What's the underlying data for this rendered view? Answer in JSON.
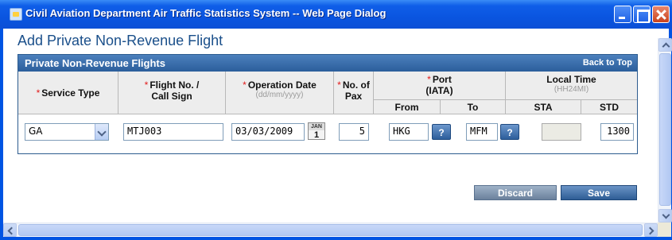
{
  "window": {
    "title": "Civil Aviation Department Air Traffic Statistics System -- Web Page Dialog"
  },
  "page": {
    "heading": "Add Private Non-Revenue Flight"
  },
  "panel": {
    "title": "Private Non-Revenue Flights",
    "back_to_top": "Back to Top"
  },
  "columns": {
    "required_marker": "*",
    "service_type": "Service Type",
    "flight_no": "Flight No. /",
    "call_sign": "Call Sign",
    "operation_date": "Operation Date",
    "operation_date_hint": "(dd/mm/yyyy)",
    "no_of": "No. of",
    "pax": "Pax",
    "port": "Port",
    "iata": "(IATA)",
    "from": "From",
    "to": "To",
    "local_time": "Local Time",
    "local_time_hint": "(HH24MI)",
    "sta": "STA",
    "std": "STD"
  },
  "form": {
    "service_type": "GA",
    "flight_no": "MTJ003",
    "operation_date": "03/03/2009",
    "calendar_month": "JAN",
    "calendar_day": "1",
    "pax": "5",
    "from": "HKG",
    "to": "MFM",
    "sta": "",
    "std": "1300",
    "help_label": "?"
  },
  "actions": {
    "discard": "Discard",
    "save": "Save"
  }
}
